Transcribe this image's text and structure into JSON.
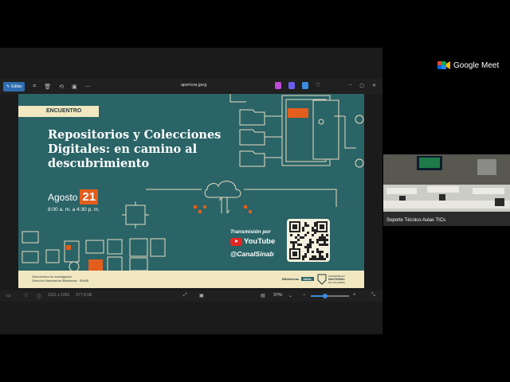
{
  "meet": {
    "brand": "Google Meet"
  },
  "viewer": {
    "edit_label": "Editar",
    "file_name": "apertura.jpeg",
    "dimensions": "1921 x 1081",
    "file_size": "677,8 kB",
    "zoom": "37%",
    "zoom_fraction": 0.37
  },
  "slide": {
    "tag": "ENCUENTRO",
    "headline_lines": [
      "Repositorios y Colecciones",
      "Digitales: en camino al",
      "descubrimiento"
    ],
    "month": "Agosto",
    "day": "21",
    "hours": "8:00 a. m. a 4:30 p. m.",
    "transmission": "Transmisión por",
    "platform": "YouTube",
    "channel": "@CanalSinab",
    "footer_left_1": "Vicerrectoría de Investigación",
    "footer_left_2": "Dirección Nacional de Bibliotecas · SINAB",
    "footer_bib": "Bibliotecas",
    "footer_bib_tag": "UNAL",
    "footer_unal_1": "UNIVERSIDAD",
    "footer_unal_2": "NACIONAL",
    "footer_unal_3": "DE COLOMBIA",
    "colors": {
      "teal": "#2a6467",
      "cream": "#f1e7c0",
      "orange": "#e35d1c",
      "line": "#e8dcc0"
    }
  },
  "participant": {
    "name": "Soporte Técnico Aulas TICs"
  }
}
